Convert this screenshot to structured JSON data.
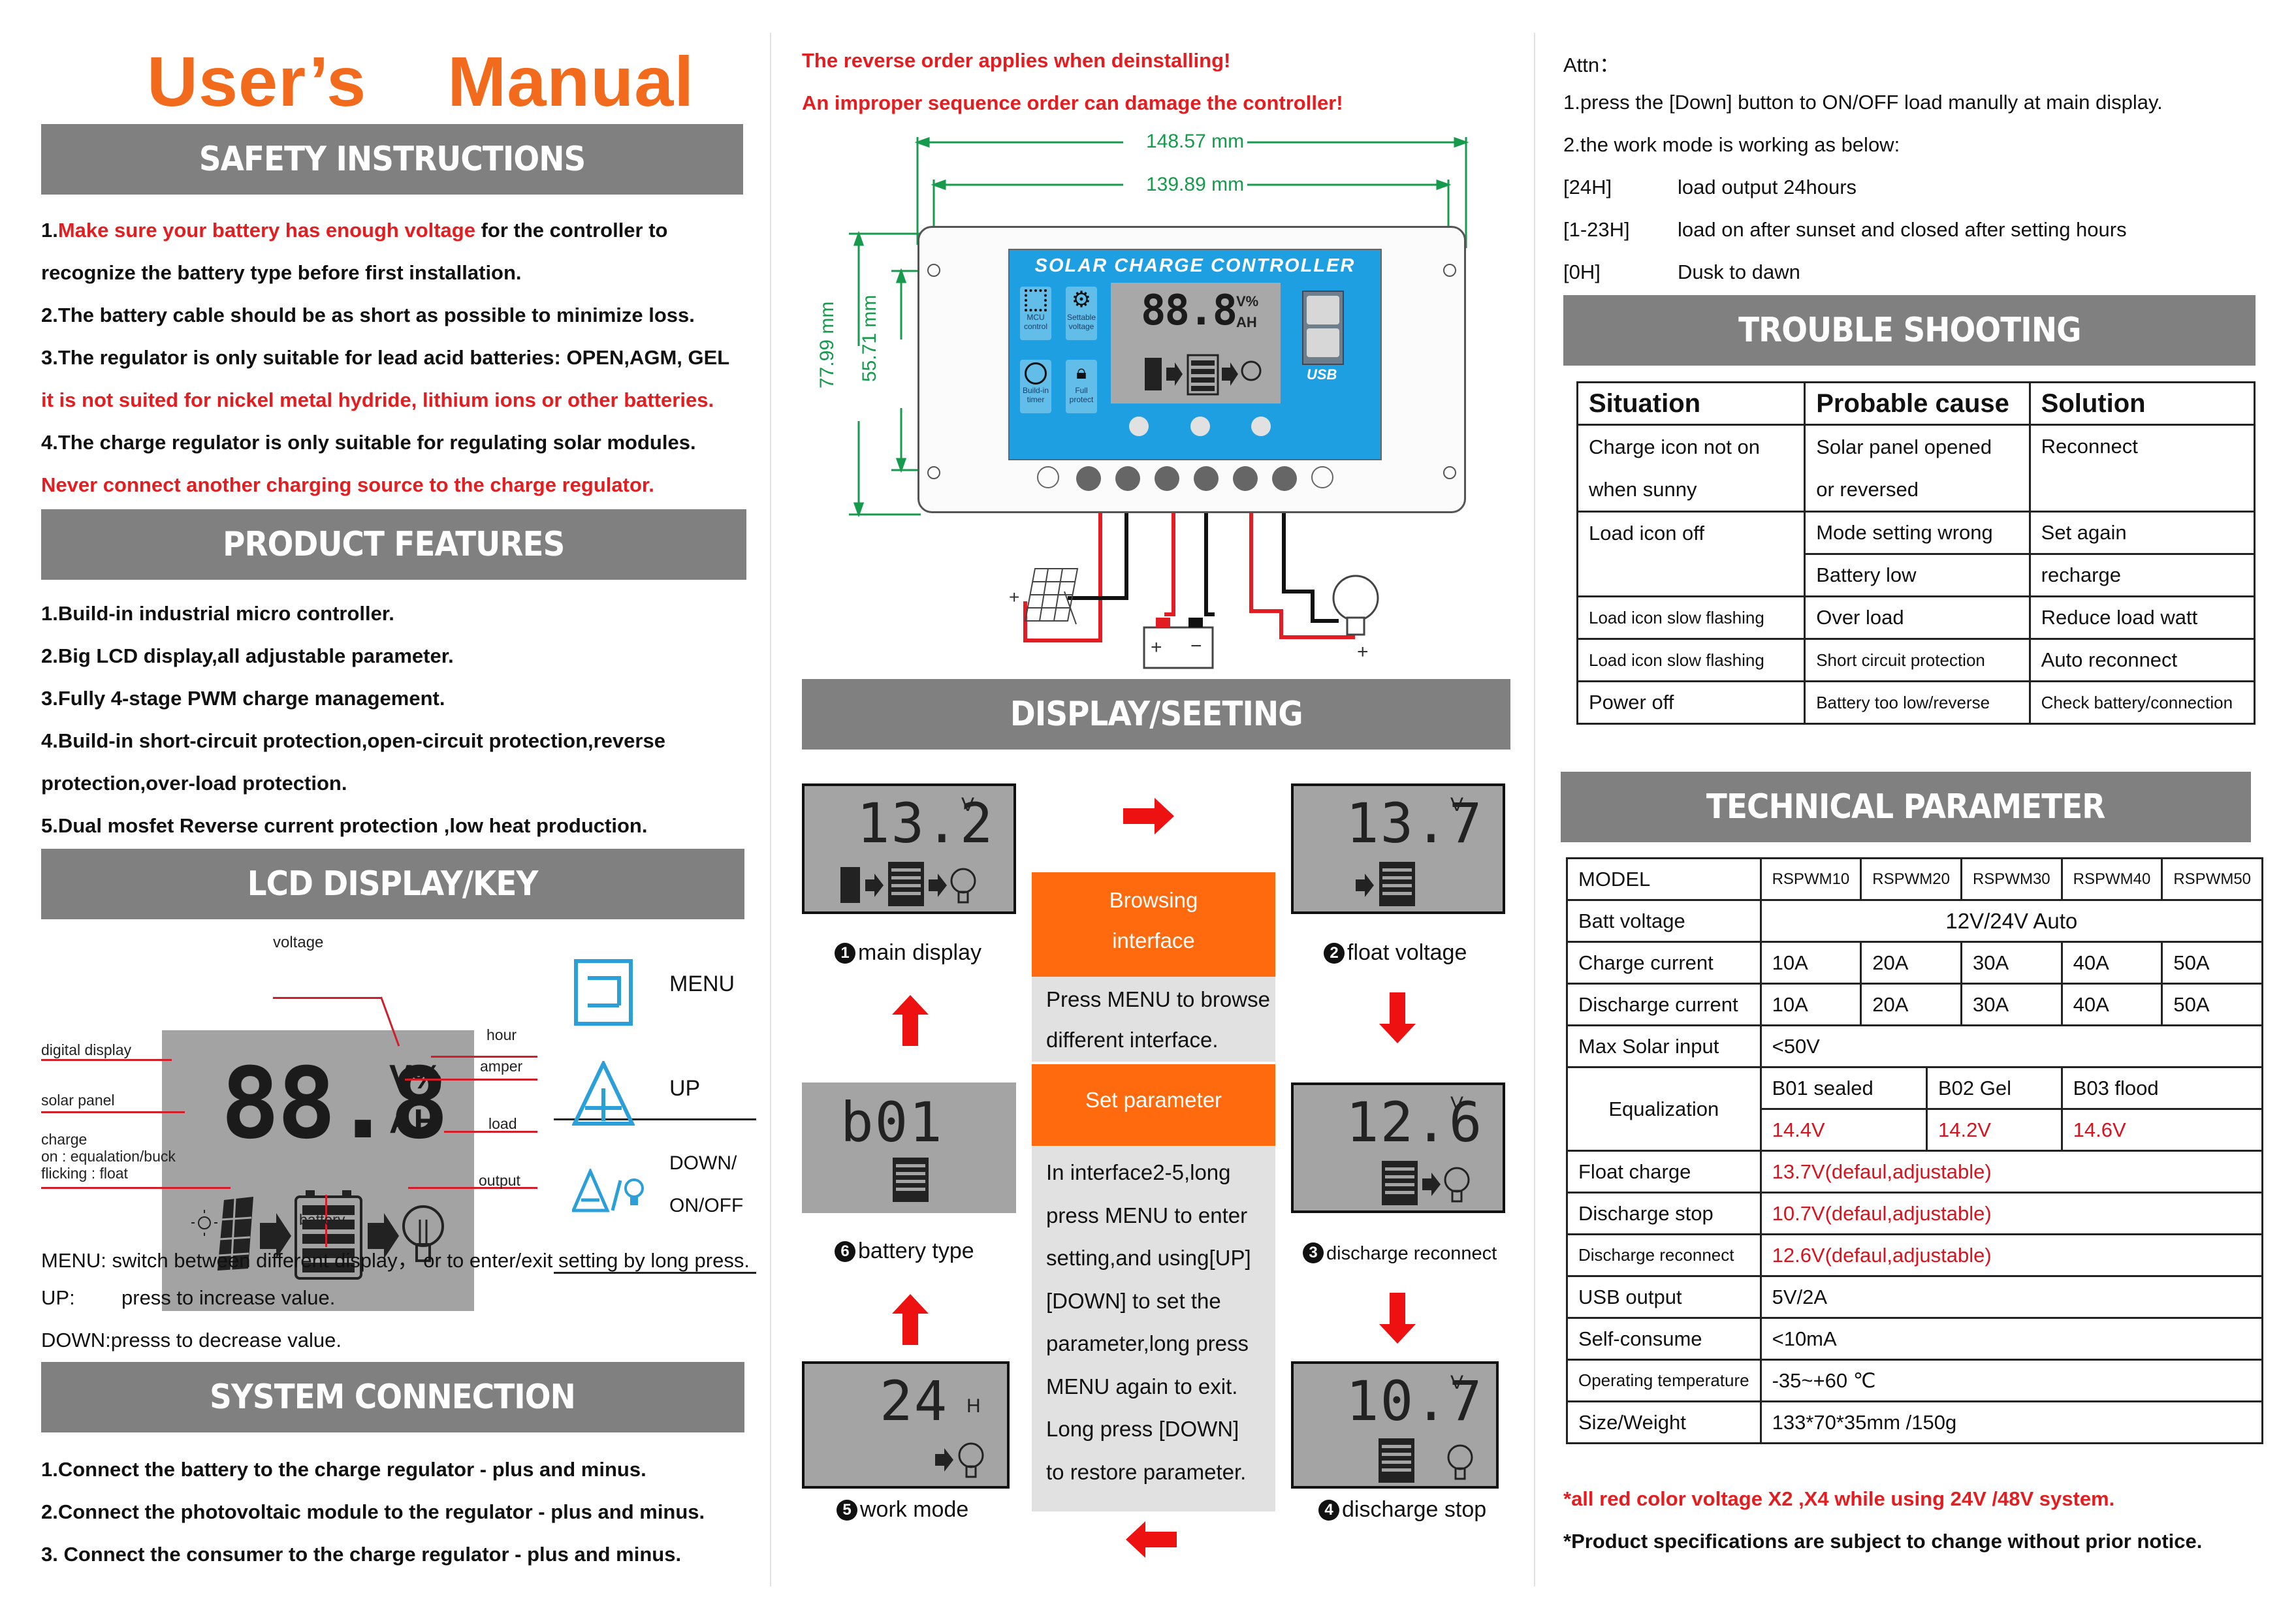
{
  "title": "User’s    Manual",
  "colors": {
    "title_orange": "#f26a1b",
    "header_gray": "#808080",
    "warning_red": "#e41e20",
    "panel_blue": "#1e9fe2",
    "lcd_gray": "#a3a3a3",
    "box_orange": "#ff6a0e",
    "box_gray": "#e1e1e1",
    "dimension_green": "#169a4b"
  },
  "safety": {
    "header": "SAFETY INSTRUCTIONS",
    "line1_prefix": "1.",
    "line1_red": "Make sure your battery has enough voltage",
    "line1_rest": " for the controller to",
    "line2": "recognize the battery type before first installation.",
    "line3": "2.The battery cable should be as short as possible to minimize loss.",
    "line4": "3.The regulator is only suitable for lead acid batteries: OPEN,AGM, GEL",
    "line5_red": "it is not suited for nickel metal hydride, lithium ions or other batteries.",
    "line6": "4.The charge regulator is only suitable for regulating solar modules.",
    "line7_red": "Never connect another charging source to the charge regulator."
  },
  "features": {
    "header": "PRODUCT FEATURES",
    "items": [
      "1.Build-in industrial micro controller.",
      "2.Big LCD display,all adjustable parameter.",
      "3.Fully 4-stage PWM charge management.",
      "4.Build-in short-circuit protection,open-circuit protection,reverse",
      "protection,over-load protection.",
      "5.Dual mosfet Reverse current protection ,low heat production."
    ]
  },
  "lcd_key": {
    "header": "LCD DISPLAY/KEY",
    "digits": "88.8",
    "unit_top": "V%",
    "unit_bottom": "AH",
    "labels": {
      "voltage": "voltage",
      "digital_display": "digital display",
      "solar_panel": "solar panel",
      "charge": "charge",
      "charge_on": "on : equalation/buck",
      "charge_flicking": "flicking : float",
      "battery": "battery",
      "hour": "hour",
      "amper": "amper",
      "load": "load",
      "output": "output"
    },
    "keys": [
      {
        "icon": "menu-icon",
        "label": "MENU"
      },
      {
        "icon": "up-icon",
        "label": "UP"
      },
      {
        "icon": "down-onoff-icon",
        "label": "DOWN/",
        "label2": "ON/OFF"
      }
    ],
    "desc": [
      {
        "key": "MENU:",
        "text": "switch between different display， or to enter/exit setting by long press."
      },
      {
        "key": "UP:",
        "text": "press to increase value."
      },
      {
        "key": "DOWN:",
        "text": "presss to decrease value."
      }
    ]
  },
  "system": {
    "header": "SYSTEM CONNECTION",
    "items": [
      "1.Connect the battery to the charge regulator - plus and minus.",
      "2.Connect the photovoltaic module to the regulator - plus and minus.",
      "3. Connect the consumer to the charge regulator - plus and minus."
    ]
  },
  "install": {
    "warning1": "The reverse order applies when deinstalling!",
    "warning2": "An improper sequence order can damage the controller!",
    "dim_outer_width": "148.57 mm",
    "dim_inner_width": "139.89 mm",
    "dim_outer_height": "77.99 mm",
    "dim_inner_height": "55.71 mm",
    "panel_title": "SOLAR CHARGE CONTROLLER",
    "panel_digits": "88.8",
    "panel_unit_top": "V%",
    "panel_unit_bottom": "AH",
    "badges": [
      {
        "icon": "chip-icon",
        "label1": "MCU",
        "label2": "control"
      },
      {
        "icon": "gear-icon",
        "label1": "Settable",
        "label2": "voltage"
      },
      {
        "icon": "clock-icon",
        "label1": "Build-in",
        "label2": "timer"
      },
      {
        "icon": "lock-icon",
        "label1": "Full",
        "label2": "protect"
      }
    ],
    "usb_label": "USB",
    "plus": "+",
    "minus": "−"
  },
  "display_setting": {
    "header": "DISPLAY/SEETING",
    "screens": [
      {
        "num": "1",
        "value": "13.2",
        "unit": "V",
        "caption": "main display"
      },
      {
        "num": "2",
        "value": "13.7",
        "unit": "V",
        "caption": "float voltage"
      },
      {
        "num": "3",
        "value": "12.6",
        "unit": "V",
        "caption": "discharge reconnect"
      },
      {
        "num": "4",
        "value": "10.7",
        "unit": "V",
        "caption": "discharge stop"
      },
      {
        "num": "5",
        "value": "24",
        "unit": "H",
        "caption": "work mode"
      },
      {
        "num": "6",
        "value": "b01",
        "unit": "",
        "caption": "battery type"
      }
    ],
    "browsing_title1": "Browsing",
    "browsing_title2": "interface",
    "browsing_text1": "Press  MENU  to  browse",
    "browsing_text2": "different    interface.",
    "set_title": "Set parameter",
    "set_text": [
      "In interface2-5,long",
      "press MENU to enter",
      "setting,and using[UP]",
      "[DOWN] to set the",
      "parameter,long press",
      "MENU again to exit.",
      "Long press [DOWN]",
      "to restore parameter."
    ]
  },
  "attn": {
    "title": "Attn：",
    "line1": "1.press the [Down] button to ON/OFF load manully at main display.",
    "line2": "2.the work mode is working as below:",
    "modes": [
      {
        "key": "[24H]",
        "desc": "load output 24hours"
      },
      {
        "key": "[1-23H]",
        "desc": "load on after sunset and closed after setting hours"
      },
      {
        "key": "[0H]",
        "desc": "Dusk to dawn"
      }
    ]
  },
  "trouble": {
    "header": "TROUBLE SHOOTING",
    "columns": [
      "Situation",
      "Probable cause",
      "Solution"
    ],
    "rows": [
      {
        "situation": "Charge icon not on",
        "situation2": "when sunny",
        "cause": "Solar   panel   opened",
        "cause2": "or reversed",
        "solution": "Reconnect"
      },
      {
        "situation": "Load icon off",
        "cause": "Mode setting wrong",
        "solution": "Set again"
      },
      {
        "cause": "Battery low",
        "solution": "recharge"
      },
      {
        "situation": "Load icon slow flashing",
        "cause": "Over load",
        "solution": "Reduce load watt"
      },
      {
        "situation": "Load icon slow flashing",
        "cause": "Short circuit protection",
        "solution": "Auto reconnect"
      },
      {
        "situation": "Power off",
        "cause": "Battery too low/reverse",
        "solution": "Check battery/connection"
      }
    ]
  },
  "tech": {
    "header": "TECHNICAL PARAMETER",
    "model_label": "MODEL",
    "models": [
      "RSPWM10",
      "RSPWM20",
      "RSPWM30",
      "RSPWM40",
      "RSPWM50"
    ],
    "batt_voltage_label": "Batt voltage",
    "batt_voltage": "12V/24V Auto",
    "charge_current_label": "Charge current",
    "charge_current": [
      "10A",
      "20A",
      "30A",
      "40A",
      "50A"
    ],
    "discharge_current_label": "Discharge current",
    "discharge_current": [
      "10A",
      "20A",
      "30A",
      "40A",
      "50A"
    ],
    "max_solar_label": "Max Solar input",
    "max_solar": "<50V",
    "equalization_label": "Equalization",
    "eq_types": [
      "B01 sealed",
      "B02 Gel",
      "B03 flood"
    ],
    "eq_values": [
      "14.4V",
      "14.2V",
      "14.6V"
    ],
    "float_label": "Float charge",
    "float_value": "13.7V(defaul,adjustable)",
    "dstop_label": "Discharge stop",
    "dstop_value": "10.7V(defaul,adjustable)",
    "drecon_label": "Discharge reconnect",
    "drecon_value": "12.6V(defaul,adjustable)",
    "usb_label": "USB output",
    "usb_value": "5V/2A",
    "self_label": "Self-consume",
    "self_value": "<10mA",
    "temp_label": "Operating temperature",
    "temp_value": "-35~+60 ℃",
    "size_label": "Size/Weight",
    "size_value": "133*70*35mm /150g",
    "note_red": "*all red color voltage X2 ,X4 while using 24V /48V system.",
    "note": "*Product specifications are subject to change without prior notice."
  }
}
